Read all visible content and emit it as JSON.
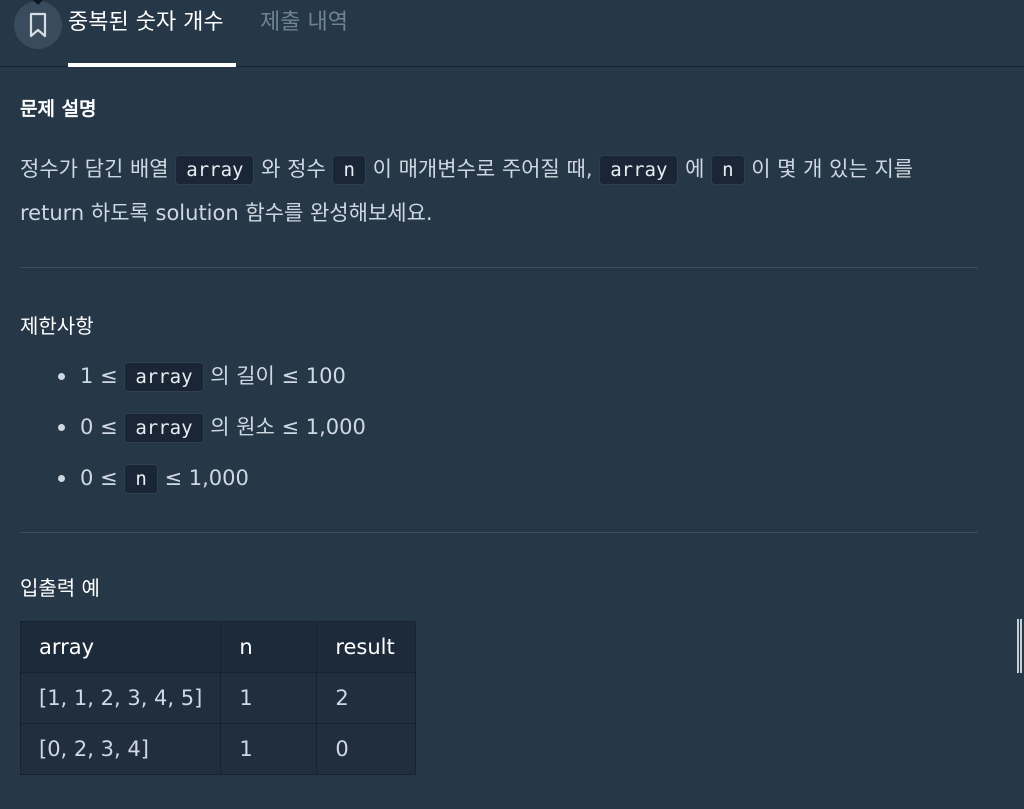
{
  "tabs": [
    {
      "label": "중복된 숫자 개수",
      "active": true
    },
    {
      "label": "제출 내역",
      "active": false
    }
  ],
  "bookmark": {
    "icon": "bookmark-icon"
  },
  "problem": {
    "heading": "문제 설명",
    "line1": {
      "t1": "정수가 담긴 배열 ",
      "c1": "array",
      "t2": " 와 정수 ",
      "c2": "n",
      "t3": " 이 매개변수로 주어질 때, ",
      "c3": "array",
      "t4": " 에 ",
      "c4": "n",
      "t5": " 이 몇 개 있는 지를"
    },
    "line2": "return 하도록 solution 함수를 완성해보세요."
  },
  "limits": {
    "heading": "제한사항",
    "items": [
      {
        "pre": "1 ≤ ",
        "code": "array",
        "post": " 의 길이 ≤ 100"
      },
      {
        "pre": "0 ≤ ",
        "code": "array",
        "post": " 의 원소 ≤ 1,000"
      },
      {
        "pre": "0 ≤ ",
        "code": "n",
        "post": "  ≤ 1,000"
      }
    ]
  },
  "examples": {
    "heading": "입출력 예",
    "columns": [
      "array",
      "n",
      "result"
    ],
    "rows": [
      [
        "[1, 1, 2, 3, 4, 5]",
        "1",
        "2"
      ],
      [
        "[0, 2, 3, 4]",
        "1",
        "0"
      ]
    ]
  },
  "colors": {
    "background": "#263747",
    "code_background": "#1a2636",
    "active_tab": "#ffffff",
    "inactive_tab": "#6f8397"
  }
}
